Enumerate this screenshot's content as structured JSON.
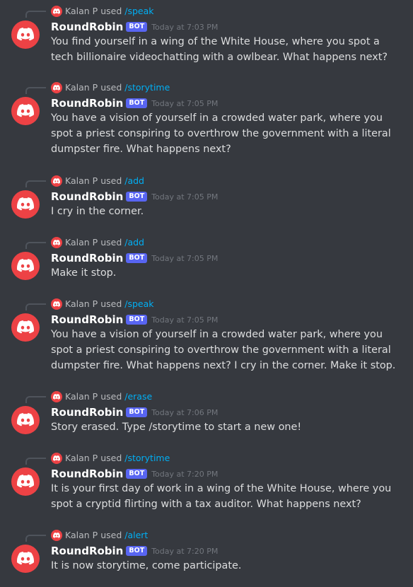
{
  "colors": {
    "background": "#36393f",
    "accent_red": "#ed4245",
    "bot_tag": "#5865f2",
    "command_link": "#00aff4"
  },
  "messages": [
    {
      "reply_user": "Kalan P",
      "reply_used": "used",
      "command": "/speak",
      "username": "RoundRobin",
      "bot_tag": "BOT",
      "timestamp": "Today at 7:03 PM",
      "text": "You find yourself in a wing of the White House, where you spot a tech billionaire videochatting with a owlbear. What happens next?"
    },
    {
      "reply_user": "Kalan P",
      "reply_used": "used",
      "command": "/storytime",
      "username": "RoundRobin",
      "bot_tag": "BOT",
      "timestamp": "Today at 7:05 PM",
      "text": "You have a vision of yourself in a crowded water park, where you spot a priest conspiring to overthrow the government with a literal dumpster fire. What happens next?"
    },
    {
      "reply_user": "Kalan P",
      "reply_used": "used",
      "command": "/add",
      "username": "RoundRobin",
      "bot_tag": "BOT",
      "timestamp": "Today at 7:05 PM",
      "text": "I cry in the corner."
    },
    {
      "reply_user": "Kalan P",
      "reply_used": "used",
      "command": "/add",
      "username": "RoundRobin",
      "bot_tag": "BOT",
      "timestamp": "Today at 7:05 PM",
      "text": "Make it stop."
    },
    {
      "reply_user": "Kalan P",
      "reply_used": "used",
      "command": "/speak",
      "username": "RoundRobin",
      "bot_tag": "BOT",
      "timestamp": "Today at 7:05 PM",
      "text": "You have a vision of yourself in a crowded water park, where you spot a priest conspiring to overthrow the government with a literal dumpster fire. What happens next? I cry in the corner. Make it stop."
    },
    {
      "reply_user": "Kalan P",
      "reply_used": "used",
      "command": "/erase",
      "username": "RoundRobin",
      "bot_tag": "BOT",
      "timestamp": "Today at 7:06 PM",
      "text": "Story erased. Type /storytime to start a new one!"
    },
    {
      "reply_user": "Kalan P",
      "reply_used": "used",
      "command": "/storytime",
      "username": "RoundRobin",
      "bot_tag": "BOT",
      "timestamp": "Today at 7:20 PM",
      "text": "It is your first day of work in a wing of the White House, where you spot a cryptid flirting with a tax auditor. What happens next?"
    },
    {
      "reply_user": "Kalan P",
      "reply_used": "used",
      "command": "/alert",
      "username": "RoundRobin",
      "bot_tag": "BOT",
      "timestamp": "Today at 7:20 PM",
      "text": "It is now storytime, come participate."
    }
  ]
}
